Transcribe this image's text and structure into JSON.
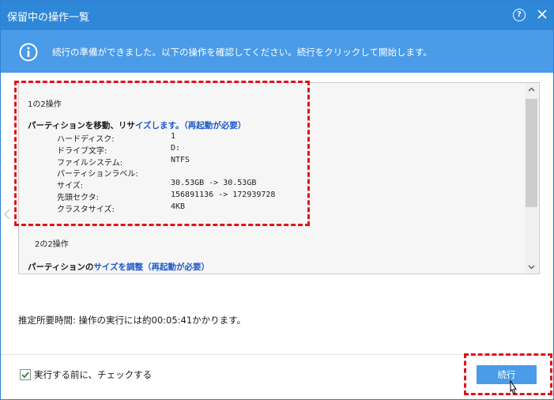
{
  "window": {
    "title": "保留中の操作一覧",
    "help_glyph": "?",
    "close_icon": "close-icon"
  },
  "banner": {
    "icon": "info-icon",
    "text": "続行の準備ができました。以下の操作を確認してください。続行をクリックして開始します。"
  },
  "operations": [
    {
      "header": "1の2操作",
      "title_a": "パーティションを移動、リサ",
      "title_b": "イズします。（再起動が必要）",
      "details": [
        {
          "label": "ハードディスク:",
          "value": "1"
        },
        {
          "label": "ドライブ文字:",
          "value": "D:"
        },
        {
          "label": "ファイルシステム:",
          "value": "NTFS"
        },
        {
          "label": "パーティションラベル:",
          "value": ""
        },
        {
          "label": "サイズ:",
          "value": "30.53GB -> 30.53GB"
        },
        {
          "label": "先頭セクタ:",
          "value": "156891136 -> 172939728"
        },
        {
          "label": "クラスタサイズ:",
          "value": "4KB"
        }
      ]
    },
    {
      "header": "2の2操作",
      "title_a": "パーティションの",
      "title_b": "サイズを調整（再起動が必要）"
    }
  ],
  "estimate_text": "推定所要時間: 操作の実行には約00:05:41かかります。",
  "footer": {
    "check_label": "実行する前に、チェックする",
    "check_checked": true,
    "continue_label": "続行"
  },
  "colors": {
    "titlebar": "#2f87d8",
    "banner": "#4a9be8",
    "button": "#4a9be8",
    "highlight": "#e3131d",
    "link_blue": "#1d58c9"
  }
}
